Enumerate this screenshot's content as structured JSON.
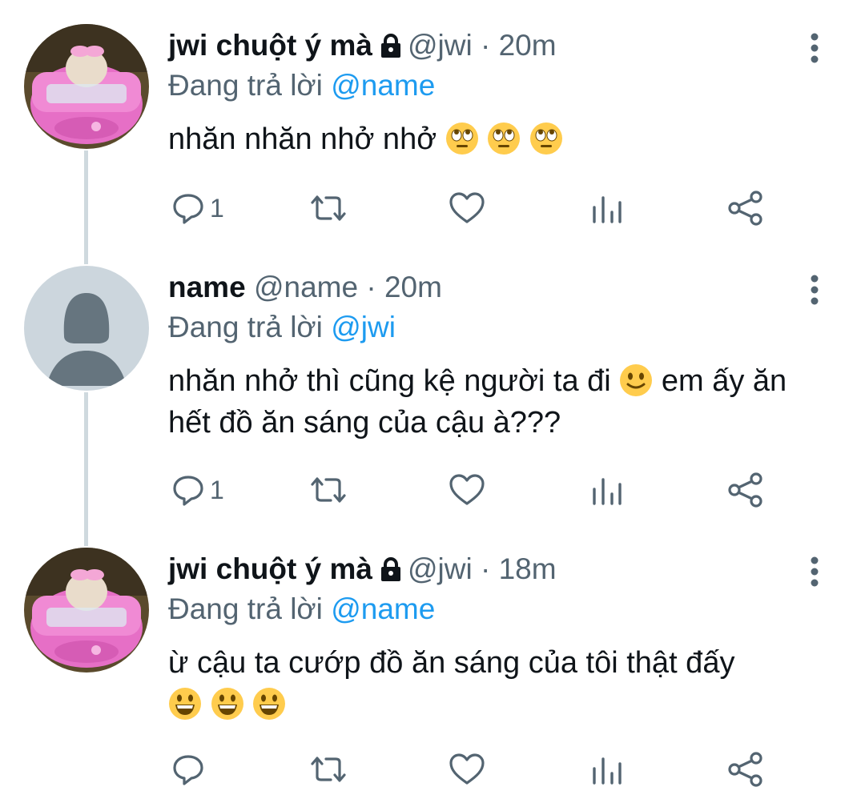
{
  "tweets": [
    {
      "name": "jwi chuột ý mà",
      "protected": true,
      "handle": "@jwi",
      "separator": "·",
      "time": "20m",
      "reply_prefix": "Đang trả lời",
      "reply_to": "@name",
      "text": "nhăn nhăn nhở nhở",
      "emojis": [
        "face-with-rolling-eyes",
        "face-with-rolling-eyes",
        "face-with-rolling-eyes"
      ],
      "reply_count": "1",
      "avatar": "hamster-in-pink-car"
    },
    {
      "name": "name",
      "protected": false,
      "handle": "@name",
      "separator": "·",
      "time": "20m",
      "reply_prefix": "Đang trả lời",
      "reply_to": "@jwi",
      "text_part1": "nhăn nhở thì cũng kệ người ta đi",
      "text_part2": "em ấy ăn hết đồ ăn sáng của cậu à???",
      "emojis": [
        "slightly-smiling-face"
      ],
      "reply_count": "1",
      "avatar": "default-profile"
    },
    {
      "name": "jwi chuột ý mà",
      "protected": true,
      "handle": "@jwi",
      "separator": "·",
      "time": "18m",
      "reply_prefix": "Đang trả lời",
      "reply_to": "@name",
      "text": "ừ cậu ta cướp đồ ăn sáng của tôi thật đấy",
      "emojis": [
        "grinning-face",
        "grinning-face",
        "grinning-face"
      ],
      "reply_count": "",
      "avatar": "hamster-in-pink-car"
    }
  ],
  "colors": {
    "text": "#0f1419",
    "secondary": "#536471",
    "mention": "#1d9bf0",
    "thread_line": "#cfd9de",
    "icon": "#536471"
  },
  "icons": [
    "reply-icon",
    "retweet-icon",
    "like-icon",
    "analytics-icon",
    "share-icon",
    "more-options-icon",
    "lock-icon"
  ]
}
